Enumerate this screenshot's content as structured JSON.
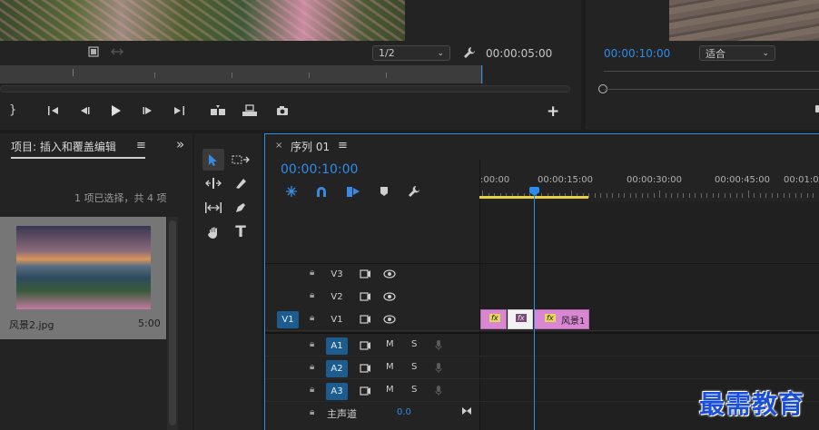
{
  "source_monitor": {
    "resolution": "1/2",
    "timecode": "00:00:05:00"
  },
  "program_monitor": {
    "timecode": "00:00:10:00",
    "zoom": "适合"
  },
  "project": {
    "tab_label": "项目: 插入和覆盖编辑",
    "selection_info": "1 项已选择，共 4 项",
    "item_name": "风景2.jpg",
    "item_duration": "5:00"
  },
  "timeline": {
    "close_glyph": "×",
    "tab_label": "序列 01",
    "timecode": "00:00:10:00",
    "ruler_labels": [
      ":00:00",
      "00:00:15:00",
      "00:00:30:00",
      "00:00:45:00",
      "00:01:0"
    ],
    "tracks": {
      "v3": "V3",
      "v2": "V2",
      "v1": "V1",
      "v1_source": "V1",
      "a1": "A1",
      "a2": "A2",
      "a3": "A3",
      "mute": "M",
      "solo": "S",
      "master_label": "主声道",
      "master_value": "0.0"
    },
    "clip_label": "风景1",
    "fx_label": "fx"
  },
  "watermark": "最需教育",
  "colors": {
    "accent": "#2d8ceb",
    "clip": "#d987d3",
    "workarea": "#e6d24a",
    "track_on": "#1d5c8f"
  }
}
